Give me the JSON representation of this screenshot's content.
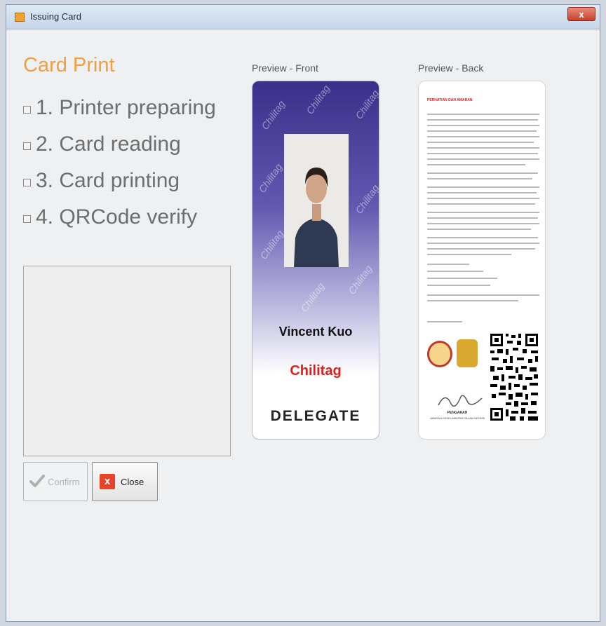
{
  "window": {
    "title": "Issuing Card",
    "close_glyph": "x"
  },
  "heading": "Card Print",
  "steps": [
    {
      "label": "1. Printer preparing"
    },
    {
      "label": "2. Card reading"
    },
    {
      "label": "3. Card printing"
    },
    {
      "label": "4. QRCode verify"
    }
  ],
  "buttons": {
    "confirm_label": "Confirm",
    "close_label": "Close",
    "close_glyph": "x"
  },
  "preview": {
    "front_label": "Preview - Front",
    "back_label": "Preview - Back",
    "front": {
      "watermark": "Chilitag",
      "name": "Vincent Kuo",
      "organization": "Chilitag",
      "role": "DELEGATE"
    },
    "back": {
      "heading": "PERHATIAN DAN AMARAN",
      "footer": "PENGARAH",
      "footer_sub": "JABATAN KESELAMATAN DALAM NEGERI"
    }
  },
  "colors": {
    "heading": "#f0a040",
    "card_top": "#3a2f8a",
    "organization": "#e02020",
    "close_icon": "#e8442a"
  },
  "icons": {
    "title": "app-icon",
    "confirm": "checkmark-icon",
    "close": "x-icon",
    "window_close": "close-icon"
  }
}
